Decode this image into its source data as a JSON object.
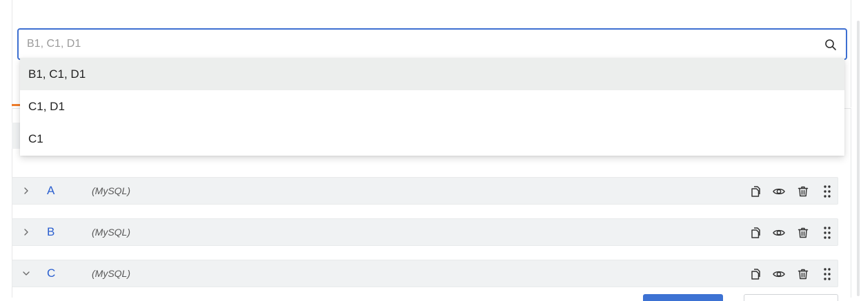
{
  "search": {
    "placeholder": "B1, C1, D1",
    "icon": "search-icon"
  },
  "dropdown": {
    "options": [
      {
        "label": "B1, C1, D1",
        "highlighted": true
      },
      {
        "label": "C1, D1",
        "highlighted": false
      },
      {
        "label": "C1",
        "highlighted": false
      }
    ]
  },
  "groups": [
    {
      "name": "A",
      "type": "(MySQL)",
      "expanded": false
    },
    {
      "name": "B",
      "type": "(MySQL)",
      "expanded": false
    },
    {
      "name": "C",
      "type": "(MySQL)",
      "expanded": true
    }
  ],
  "row_actions": [
    "copy-icon",
    "eye-icon",
    "trash-icon",
    "drag-handle-icon"
  ],
  "colors": {
    "accent": "#3d6fd1",
    "group_name": "#2a5fcf",
    "active_tab": "#ef7d2b",
    "row_bg": "#f0f2f3"
  }
}
